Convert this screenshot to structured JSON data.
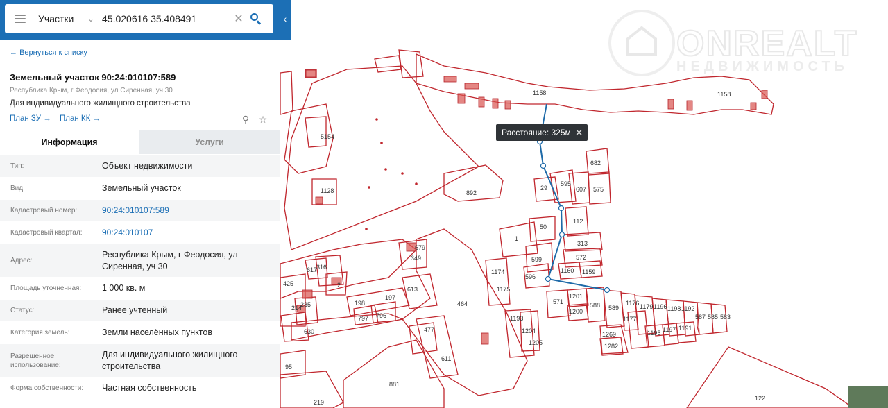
{
  "search": {
    "scope": "Участки",
    "query": "45.020616 35.408491"
  },
  "card": {
    "back_link": "Вернуться к списку",
    "title": "Земельный участок 90:24:010107:589",
    "address_sub": "Республика Крым, г Феодосия, ул Сиренная, уч 30",
    "purpose": "Для индивидуального жилищного строительства",
    "plan_zu": "План ЗУ",
    "plan_kk": "План КК"
  },
  "tabs": [
    "Информация",
    "Услуги"
  ],
  "rows": [
    {
      "label": "Тип:",
      "value": "Объект недвижимости"
    },
    {
      "label": "Вид:",
      "value": "Земельный участок"
    },
    {
      "label": "Кадастровый номер:",
      "value": "90:24:010107:589"
    },
    {
      "label": "Кадастровый квартал:",
      "value": "90:24:010107"
    },
    {
      "label": "Адрес:",
      "value": "Республика Крым, г Феодосия, ул Сиренная, уч 30"
    },
    {
      "label": "Площадь уточненная:",
      "value": "1 000 кв. м"
    },
    {
      "label": "Статус:",
      "value": "Ранее учтенный"
    },
    {
      "label": "Категория земель:",
      "value": "Земли населённых пунктов"
    },
    {
      "label": "Разрешенное использование:",
      "value": "Для индивидуального жилищного строительства"
    },
    {
      "label": "Форма собственности:",
      "value": "Частная собственность"
    }
  ],
  "map": {
    "distance": "Расстояние: 325м",
    "watermark": "ONREALT",
    "watermark_sub": "НЕДВИЖИМОСТЬ",
    "parcels": [
      "1158",
      "1158",
      "682",
      "595",
      "607",
      "575",
      "29",
      "50",
      "1",
      "112",
      "313",
      "572",
      "1160",
      "1159",
      "599",
      "596",
      "892",
      "1128",
      "5154",
      "679",
      "349",
      "617",
      "316",
      "425",
      "235",
      "214",
      "2",
      "613",
      "197",
      "198",
      "797",
      "796",
      "630",
      "464",
      "1174",
      "1175",
      "1193",
      "1204",
      "1205",
      "477",
      "611",
      "571",
      "1201",
      "1200",
      "588",
      "589",
      "1176",
      "1177",
      "1179",
      "1196",
      "1198",
      "1192",
      "587",
      "585",
      "583",
      "1195",
      "1197",
      "1191",
      "1269",
      "1282",
      "881",
      "219",
      "95",
      "122"
    ]
  },
  "colors": {
    "header": "#1c6fb5",
    "parcel_stroke": "#c0262d",
    "parcel_fill": "#d9534f",
    "route": "#1e6aa8"
  }
}
